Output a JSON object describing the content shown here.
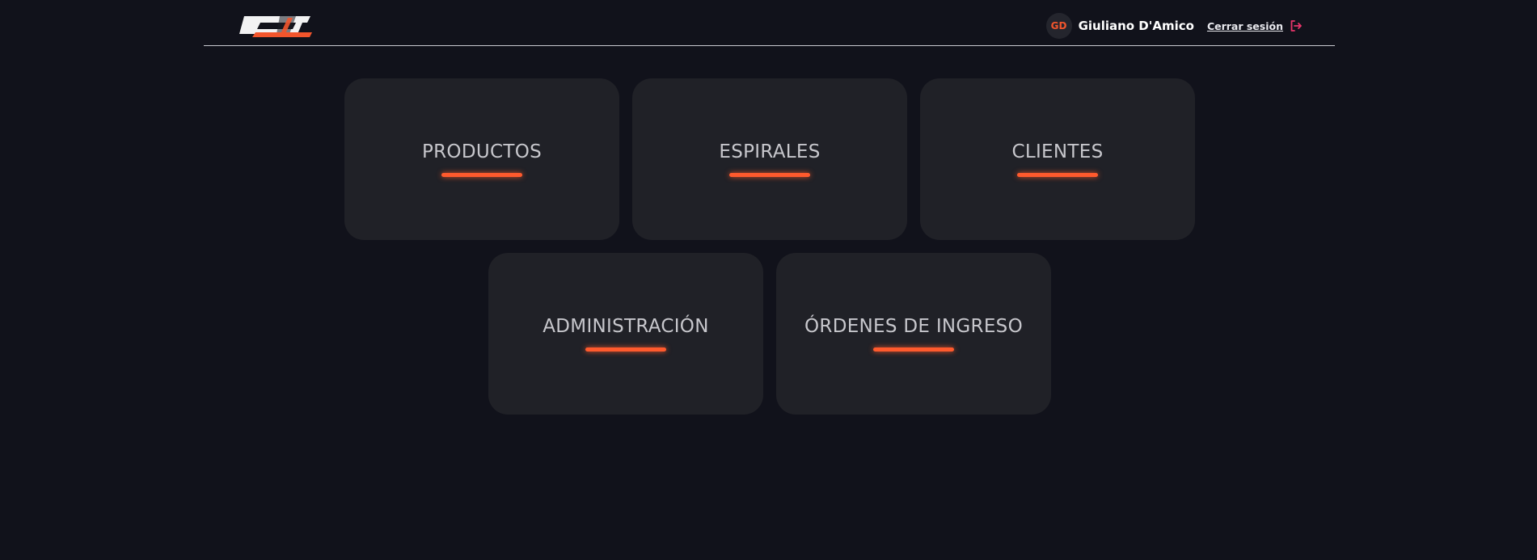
{
  "header": {
    "logo_name": "cg-logo",
    "user": {
      "initials": "GD",
      "name": "Giuliano D'Amico"
    },
    "logout_label": "Cerrar sesión"
  },
  "menu": [
    {
      "label": "PRODUCTOS"
    },
    {
      "label": "ESPIRALES"
    },
    {
      "label": "CLIENTES"
    },
    {
      "label": "ADMINISTRACIÓN"
    },
    {
      "label": "ÓRDENES DE INGRESO"
    }
  ],
  "colors": {
    "background": "#11121b",
    "card": "#202127",
    "accent": "#ff5a2d",
    "logout_icon": "#e8356a"
  }
}
